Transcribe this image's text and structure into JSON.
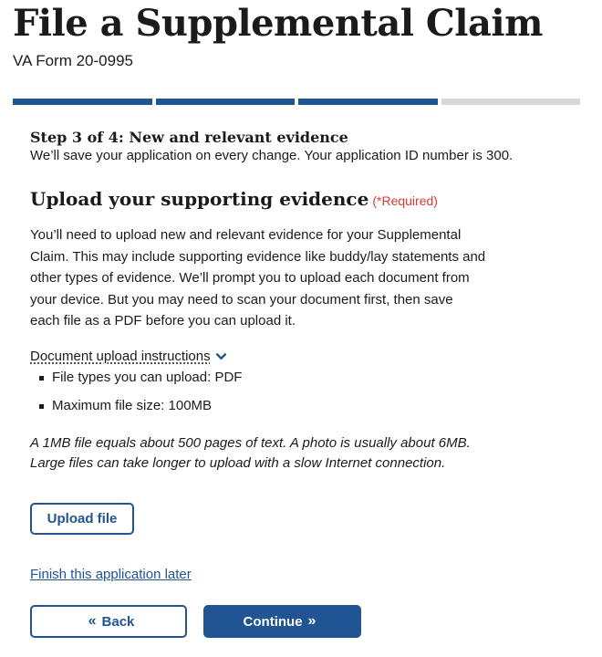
{
  "header": {
    "title": "File a Supplemental Claim",
    "subtitle": "VA Form 20-0995"
  },
  "progress": {
    "total_steps": 4,
    "current_step": 3,
    "completed_color": "#205493",
    "remaining_color": "#d6d7d9"
  },
  "step": {
    "title": "Step 3 of 4: New and relevant evidence",
    "note": "We’ll save your application on every change. Your application ID number is 300."
  },
  "section": {
    "title": "Upload your supporting evidence",
    "required": "(*Required)",
    "intro": "You’ll need to upload new and relevant evidence for your Supplemental Claim. This may include supporting evidence like buddy/lay statements and other types of evidence. We’ll prompt you to upload each document from your device. But you may need to scan your document first, then save each file as a PDF before you can upload it."
  },
  "instructions": {
    "link": "Document upload instructions",
    "icon": "chevron-down-icon",
    "items": [
      "File types you can upload: PDF",
      "Maximum file size: 100MB"
    ],
    "note": "A 1MB file equals about 500 pages of text. A photo is usually about 6MB. Large files can take longer to upload with a slow Internet connection."
  },
  "actions": {
    "upload": "Upload file",
    "finish_later": "Finish this application later",
    "back": "Back",
    "back_arrow": "«",
    "continue": "Continue",
    "continue_arrow": "»"
  },
  "colors": {
    "primary": "#205493",
    "required": "#d83933",
    "text": "#1b1b1b"
  }
}
